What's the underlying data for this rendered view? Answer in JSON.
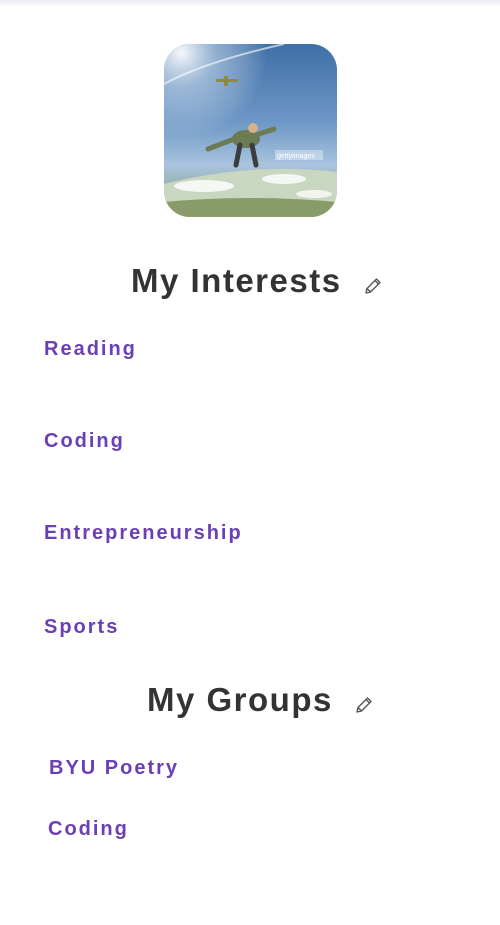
{
  "profile": {
    "photo_icon": "skydiver-photo",
    "photo_watermark": "gettyimages"
  },
  "interests": {
    "title": "My Interests",
    "edit_icon": "pencil-icon",
    "items": [
      {
        "label": "Reading"
      },
      {
        "label": "Coding"
      },
      {
        "label": "Entrepreneurship"
      },
      {
        "label": "Sports"
      }
    ]
  },
  "groups": {
    "title": "My Groups",
    "edit_icon": "pencil-icon",
    "items": [
      {
        "label": "BYU Poetry"
      },
      {
        "label": "Coding"
      }
    ]
  },
  "colors": {
    "accent": "#6b3fb5",
    "title": "#333333",
    "background": "#ffffff"
  }
}
